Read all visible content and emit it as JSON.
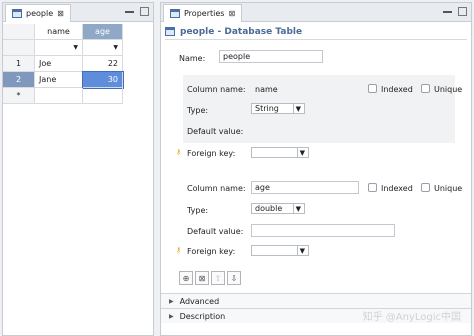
{
  "left": {
    "tab_title": "people",
    "tab_close": "⊠",
    "columns": [
      "name",
      "age"
    ],
    "rows": [
      {
        "num": "1",
        "name": "Joe",
        "age": "22"
      },
      {
        "num": "2",
        "name": "Jane",
        "age": "30"
      },
      {
        "num": "*",
        "name": "",
        "age": ""
      }
    ]
  },
  "right": {
    "tab_title": "Properties",
    "tab_close": "⊠",
    "title": "people - Database Table",
    "name_label": "Name:",
    "name_value": "people",
    "col1": {
      "label": "Column name:",
      "value": "name",
      "indexed": "Indexed",
      "unique": "Unique",
      "type_label": "Type:",
      "type_value": "String",
      "default_label": "Default value:",
      "fk_label": "Foreign key:"
    },
    "col2": {
      "label": "Column name:",
      "value": "age",
      "indexed": "Indexed",
      "unique": "Unique",
      "type_label": "Type:",
      "type_value": "double",
      "default_label": "Default value:",
      "fk_label": "Foreign key:"
    },
    "sections": [
      "Advanced",
      "Description"
    ]
  },
  "watermark": "知乎 @AnyLogic中国"
}
